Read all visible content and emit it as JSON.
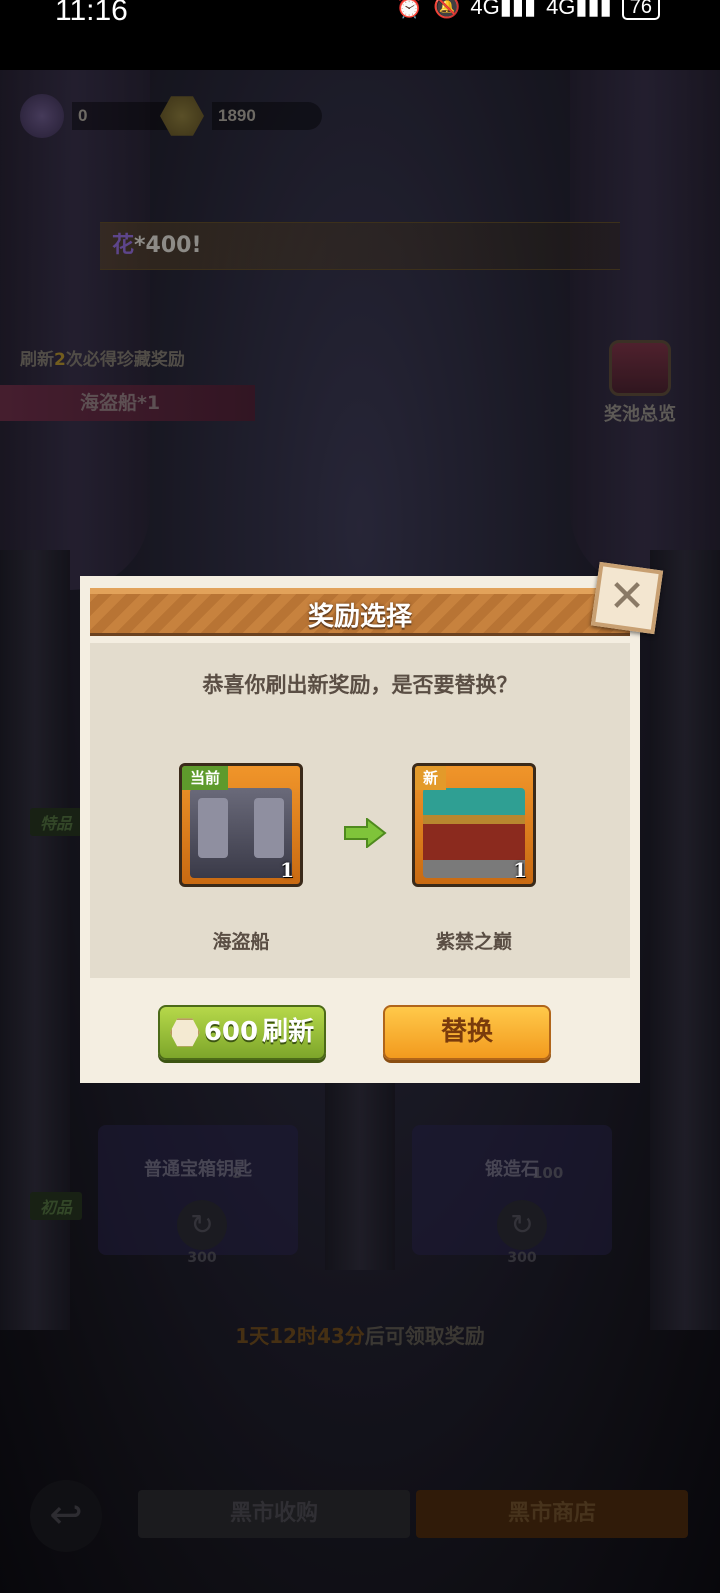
{
  "status": {
    "time": "11:16",
    "network1": "4G",
    "network2": "4G",
    "battery": "76"
  },
  "resources": {
    "currency_a": "0",
    "currency_b": "1890"
  },
  "banner": {
    "prefix": "花",
    "text": "*400!"
  },
  "hint": {
    "pre": "刷新",
    "count": "2",
    "post": "次必得珍藏奖励"
  },
  "ship_tag": "海盗船*1",
  "pool": {
    "label": "奖池总览"
  },
  "tiers": {
    "special": "特品",
    "basic": "初品"
  },
  "shop": {
    "items": [
      {
        "name": "普通宝箱钥匙",
        "qty": "5",
        "cost": "300"
      },
      {
        "name": "锻造石",
        "qty": "100",
        "cost": "300"
      }
    ]
  },
  "timer": {
    "time": "1天12时43分",
    "post": "后可领取奖励"
  },
  "bottom": {
    "tab_buy": "黑市收购",
    "tab_shop": "黑市商店",
    "back_icon": "back-arrow-icon"
  },
  "dialog": {
    "title": "奖励选择",
    "message": "恭喜你刷出新奖励，是否要替换？",
    "current": {
      "tag": "当前",
      "name": "海盗船",
      "qty": "1"
    },
    "new": {
      "tag": "新",
      "name": "紫禁之巅",
      "qty": "1"
    },
    "refresh_cost": "600",
    "refresh_label": "刷新",
    "replace_label": "替换",
    "close_icon": "close-icon"
  },
  "colors": {
    "accent_green": "#7da62a",
    "accent_orange": "#f29a1e",
    "header_brown": "#c7823e"
  }
}
